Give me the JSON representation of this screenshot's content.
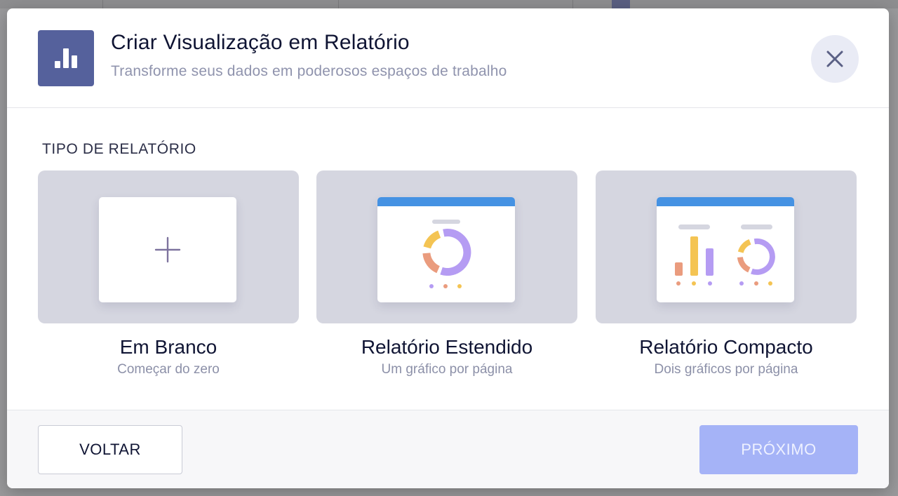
{
  "header": {
    "title": "Criar Visualização em Relatório",
    "subtitle": "Transforme seus dados em poderosos espaços de trabalho",
    "icon": "bar-chart-icon",
    "close_icon": "close-icon"
  },
  "section": {
    "label": "TIPO DE RELATÓRIO"
  },
  "report_types": [
    {
      "title": "Em Branco",
      "subtitle": "Começar do zero",
      "icon": "plus-icon"
    },
    {
      "title": "Relatório Estendido",
      "subtitle": "Um gráfico por página",
      "icon": "extended-report-preview"
    },
    {
      "title": "Relatório Compacto",
      "subtitle": "Dois gráficos por página",
      "icon": "compact-report-preview"
    }
  ],
  "footer": {
    "back_label": "VOLTAR",
    "next_label": "PRÓXIMO"
  },
  "colors": {
    "accent": "#55619c",
    "next_button": "#a5b3f7",
    "page_header": "#4592e3",
    "chart_purple": "#b59cf3",
    "chart_orange": "#ea9c7e",
    "chart_yellow": "#f4c453"
  }
}
